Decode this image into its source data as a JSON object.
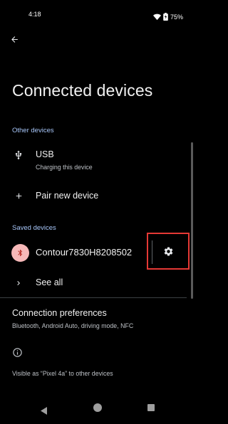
{
  "status_bar": {
    "time": "4:18",
    "battery_percent": "75%"
  },
  "page": {
    "title": "Connected devices"
  },
  "other_devices": {
    "header": "Other devices",
    "usb": {
      "title": "USB",
      "subtitle": "Charging this device"
    },
    "pair_new": {
      "title": "Pair new device"
    }
  },
  "saved_devices": {
    "header": "Saved devices",
    "device": {
      "name": "Contour7830H8208502"
    },
    "see_all": {
      "title": "See all"
    }
  },
  "connection_preferences": {
    "title": "Connection preferences",
    "subtitle": "Bluetooth, Android Auto, driving mode, NFC"
  },
  "footer": {
    "visibility_text": "Visible as “Pixel 4a” to other devices"
  },
  "colors": {
    "accent": "#a8c7fa",
    "highlight_box": "#e53935",
    "bt_avatar": "#f6b8b8"
  }
}
